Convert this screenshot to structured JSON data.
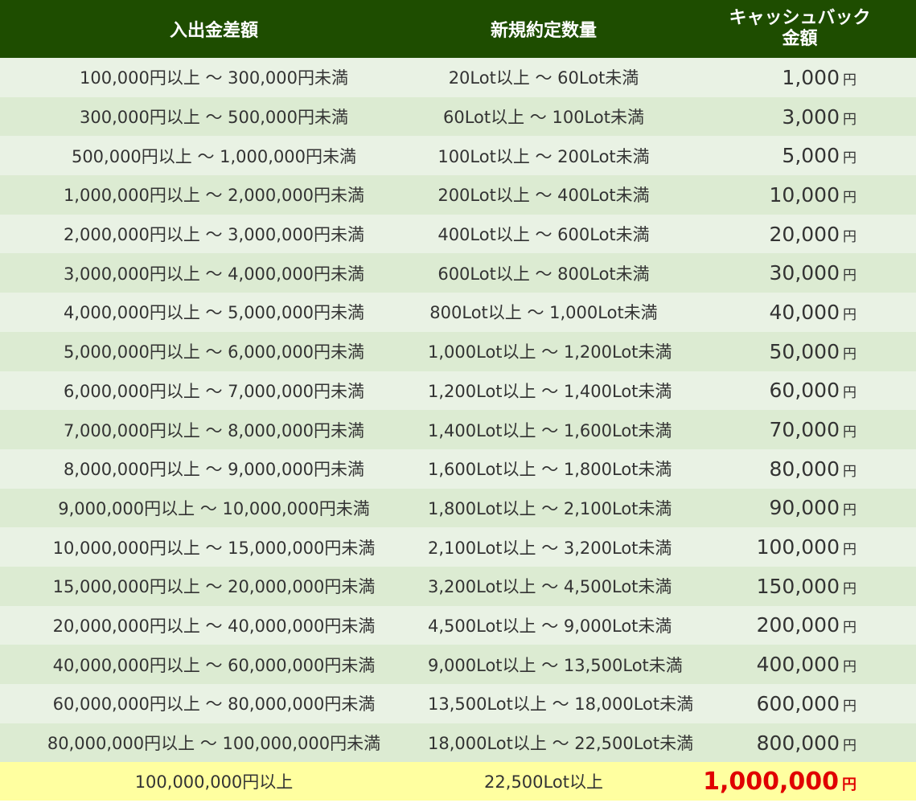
{
  "header": {
    "deposit_label": "入出金差額",
    "lots_label": "新規約定数量",
    "cashback_label_line1": "キャッシュバック",
    "cashback_label_line2": "金額"
  },
  "currency_unit": "円",
  "rows": [
    {
      "deposit": "100,000円以上 〜 300,000円未満",
      "lots": "20Lot以上 〜 60Lot未満",
      "cashback": "1,000"
    },
    {
      "deposit": "300,000円以上 〜 500,000円未満",
      "lots": "60Lot以上 〜 100Lot未満",
      "cashback": "3,000"
    },
    {
      "deposit": "500,000円以上 〜 1,000,000円未満",
      "lots": "100Lot以上 〜 200Lot未満",
      "cashback": "5,000"
    },
    {
      "deposit": "1,000,000円以上 〜 2,000,000円未満",
      "lots": "200Lot以上 〜 400Lot未満",
      "cashback": "10,000"
    },
    {
      "deposit": "2,000,000円以上 〜 3,000,000円未満",
      "lots": "400Lot以上 〜 600Lot未満",
      "cashback": "20,000"
    },
    {
      "deposit": "3,000,000円以上 〜 4,000,000円未満",
      "lots": "600Lot以上 〜 800Lot未満",
      "cashback": "30,000"
    },
    {
      "deposit": "4,000,000円以上 〜 5,000,000円未満",
      "lots": "800Lot以上 〜 1,000Lot未満",
      "cashback": "40,000"
    },
    {
      "deposit": "5,000,000円以上 〜 6,000,000円未満",
      "lots": "1,000Lot以上 〜 1,200Lot未満",
      "cashback": "50,000"
    },
    {
      "deposit": "6,000,000円以上 〜 7,000,000円未満",
      "lots": "1,200Lot以上 〜 1,400Lot未満",
      "cashback": "60,000"
    },
    {
      "deposit": "7,000,000円以上 〜 8,000,000円未満",
      "lots": "1,400Lot以上 〜 1,600Lot未満",
      "cashback": "70,000"
    },
    {
      "deposit": "8,000,000円以上 〜 9,000,000円未満",
      "lots": "1,600Lot以上 〜 1,800Lot未満",
      "cashback": "80,000"
    },
    {
      "deposit": "9,000,000円以上 〜 10,000,000円未満",
      "lots": "1,800Lot以上 〜 2,100Lot未満",
      "cashback": "90,000"
    },
    {
      "deposit": "10,000,000円以上 〜 15,000,000円未満",
      "lots": "2,100Lot以上 〜 3,200Lot未満",
      "cashback": "100,000"
    },
    {
      "deposit": "15,000,000円以上 〜 20,000,000円未満",
      "lots": "3,200Lot以上 〜 4,500Lot未満",
      "cashback": "150,000"
    },
    {
      "deposit": "20,000,000円以上 〜 40,000,000円未満",
      "lots": "4,500Lot以上 〜 9,000Lot未満",
      "cashback": "200,000"
    },
    {
      "deposit": "40,000,000円以上 〜 60,000,000円未満",
      "lots": "9,000Lot以上 〜 13,500Lot未満",
      "cashback": "400,000"
    },
    {
      "deposit": "60,000,000円以上 〜 80,000,000円未満",
      "lots": "13,500Lot以上 〜 18,000Lot未満",
      "cashback": "600,000"
    },
    {
      "deposit": "80,000,000円以上 〜 100,000,000円未満",
      "lots": "18,000Lot以上 〜 22,500Lot未満",
      "cashback": "800,000"
    }
  ],
  "final_row": {
    "deposit": "100,000,000円以上",
    "lots": "22,500Lot以上",
    "cashback": "1,000,000"
  },
  "colors": {
    "header_bg": "#1e4d00",
    "row_odd_bg": "#e9f2e4",
    "row_even_bg": "#dcebd2",
    "final_row_bg": "#ffffa0",
    "highlight_text": "#e00000"
  }
}
